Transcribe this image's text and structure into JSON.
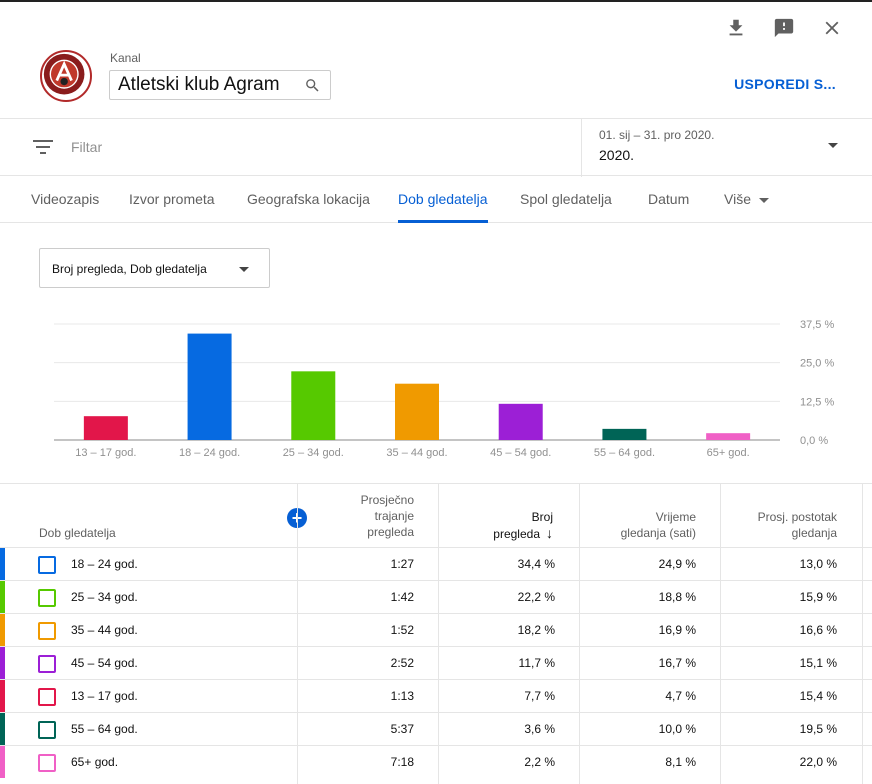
{
  "header": {
    "kanal_label": "Kanal",
    "channel_name": "Atletski klub Agram",
    "compare_label": "USPOREDI S..."
  },
  "filter": {
    "placeholder": "Filtar",
    "date_range": "01. sij – 31. pro 2020.",
    "date_label": "2020."
  },
  "tabs": [
    {
      "label": "Videozapis"
    },
    {
      "label": "Izvor prometa"
    },
    {
      "label": "Geografska lokacija"
    },
    {
      "label": "Dob gledatelja"
    },
    {
      "label": "Spol gledatelja"
    },
    {
      "label": "Datum"
    },
    {
      "label": "Više"
    }
  ],
  "metric_select": "Broj pregleda, Dob gledatelja",
  "chart_data": {
    "type": "bar",
    "categories": [
      "13 – 17 god.",
      "18 – 24 god.",
      "25 – 34 god.",
      "35 – 44 god.",
      "45 – 54 god.",
      "55 – 64 god.",
      "65+ god."
    ],
    "values": [
      7.7,
      34.4,
      22.2,
      18.2,
      11.7,
      3.6,
      2.2
    ],
    "colors": [
      "#e2164a",
      "#066ae1",
      "#56c900",
      "#f09a00",
      "#9c1fd6",
      "#006456",
      "#f060c6"
    ],
    "yticks": [
      "37,5 %",
      "25,0 %",
      "12,5 %",
      "0,0 %"
    ],
    "ylim": [
      0,
      37.5
    ]
  },
  "table": {
    "headers": {
      "dim": "Dob gledatelja",
      "avg_duration": [
        "Prosječno",
        "trajanje",
        "pregleda"
      ],
      "views": [
        "Broj",
        "pregleda"
      ],
      "watch_time": [
        "Vrijeme",
        "gledanja (sati)"
      ],
      "avg_pct": [
        "Prosj. postotak",
        "gledanja"
      ]
    },
    "rows": [
      {
        "label": "18 – 24 god.",
        "color": "#066ae1",
        "avg_duration": "1:27",
        "views": "34,4 %",
        "watch_time": "24,9 %",
        "avg_pct": "13,0 %"
      },
      {
        "label": "25 – 34 god.",
        "color": "#56c900",
        "avg_duration": "1:42",
        "views": "22,2 %",
        "watch_time": "18,8 %",
        "avg_pct": "15,9 %"
      },
      {
        "label": "35 – 44 god.",
        "color": "#f09a00",
        "avg_duration": "1:52",
        "views": "18,2 %",
        "watch_time": "16,9 %",
        "avg_pct": "16,6 %"
      },
      {
        "label": "45 – 54 god.",
        "color": "#9c1fd6",
        "avg_duration": "2:52",
        "views": "11,7 %",
        "watch_time": "16,7 %",
        "avg_pct": "15,1 %"
      },
      {
        "label": "13 – 17 god.",
        "color": "#e2164a",
        "avg_duration": "1:13",
        "views": "7,7 %",
        "watch_time": "4,7 %",
        "avg_pct": "15,4 %"
      },
      {
        "label": "55 – 64 god.",
        "color": "#006456",
        "avg_duration": "5:37",
        "views": "3,6 %",
        "watch_time": "10,0 %",
        "avg_pct": "19,5 %"
      },
      {
        "label": "65+ god.",
        "color": "#f060c6",
        "avg_duration": "7:18",
        "views": "2,2 %",
        "watch_time": "8,1 %",
        "avg_pct": "22,0 %"
      }
    ]
  },
  "accent": "#065fd4"
}
